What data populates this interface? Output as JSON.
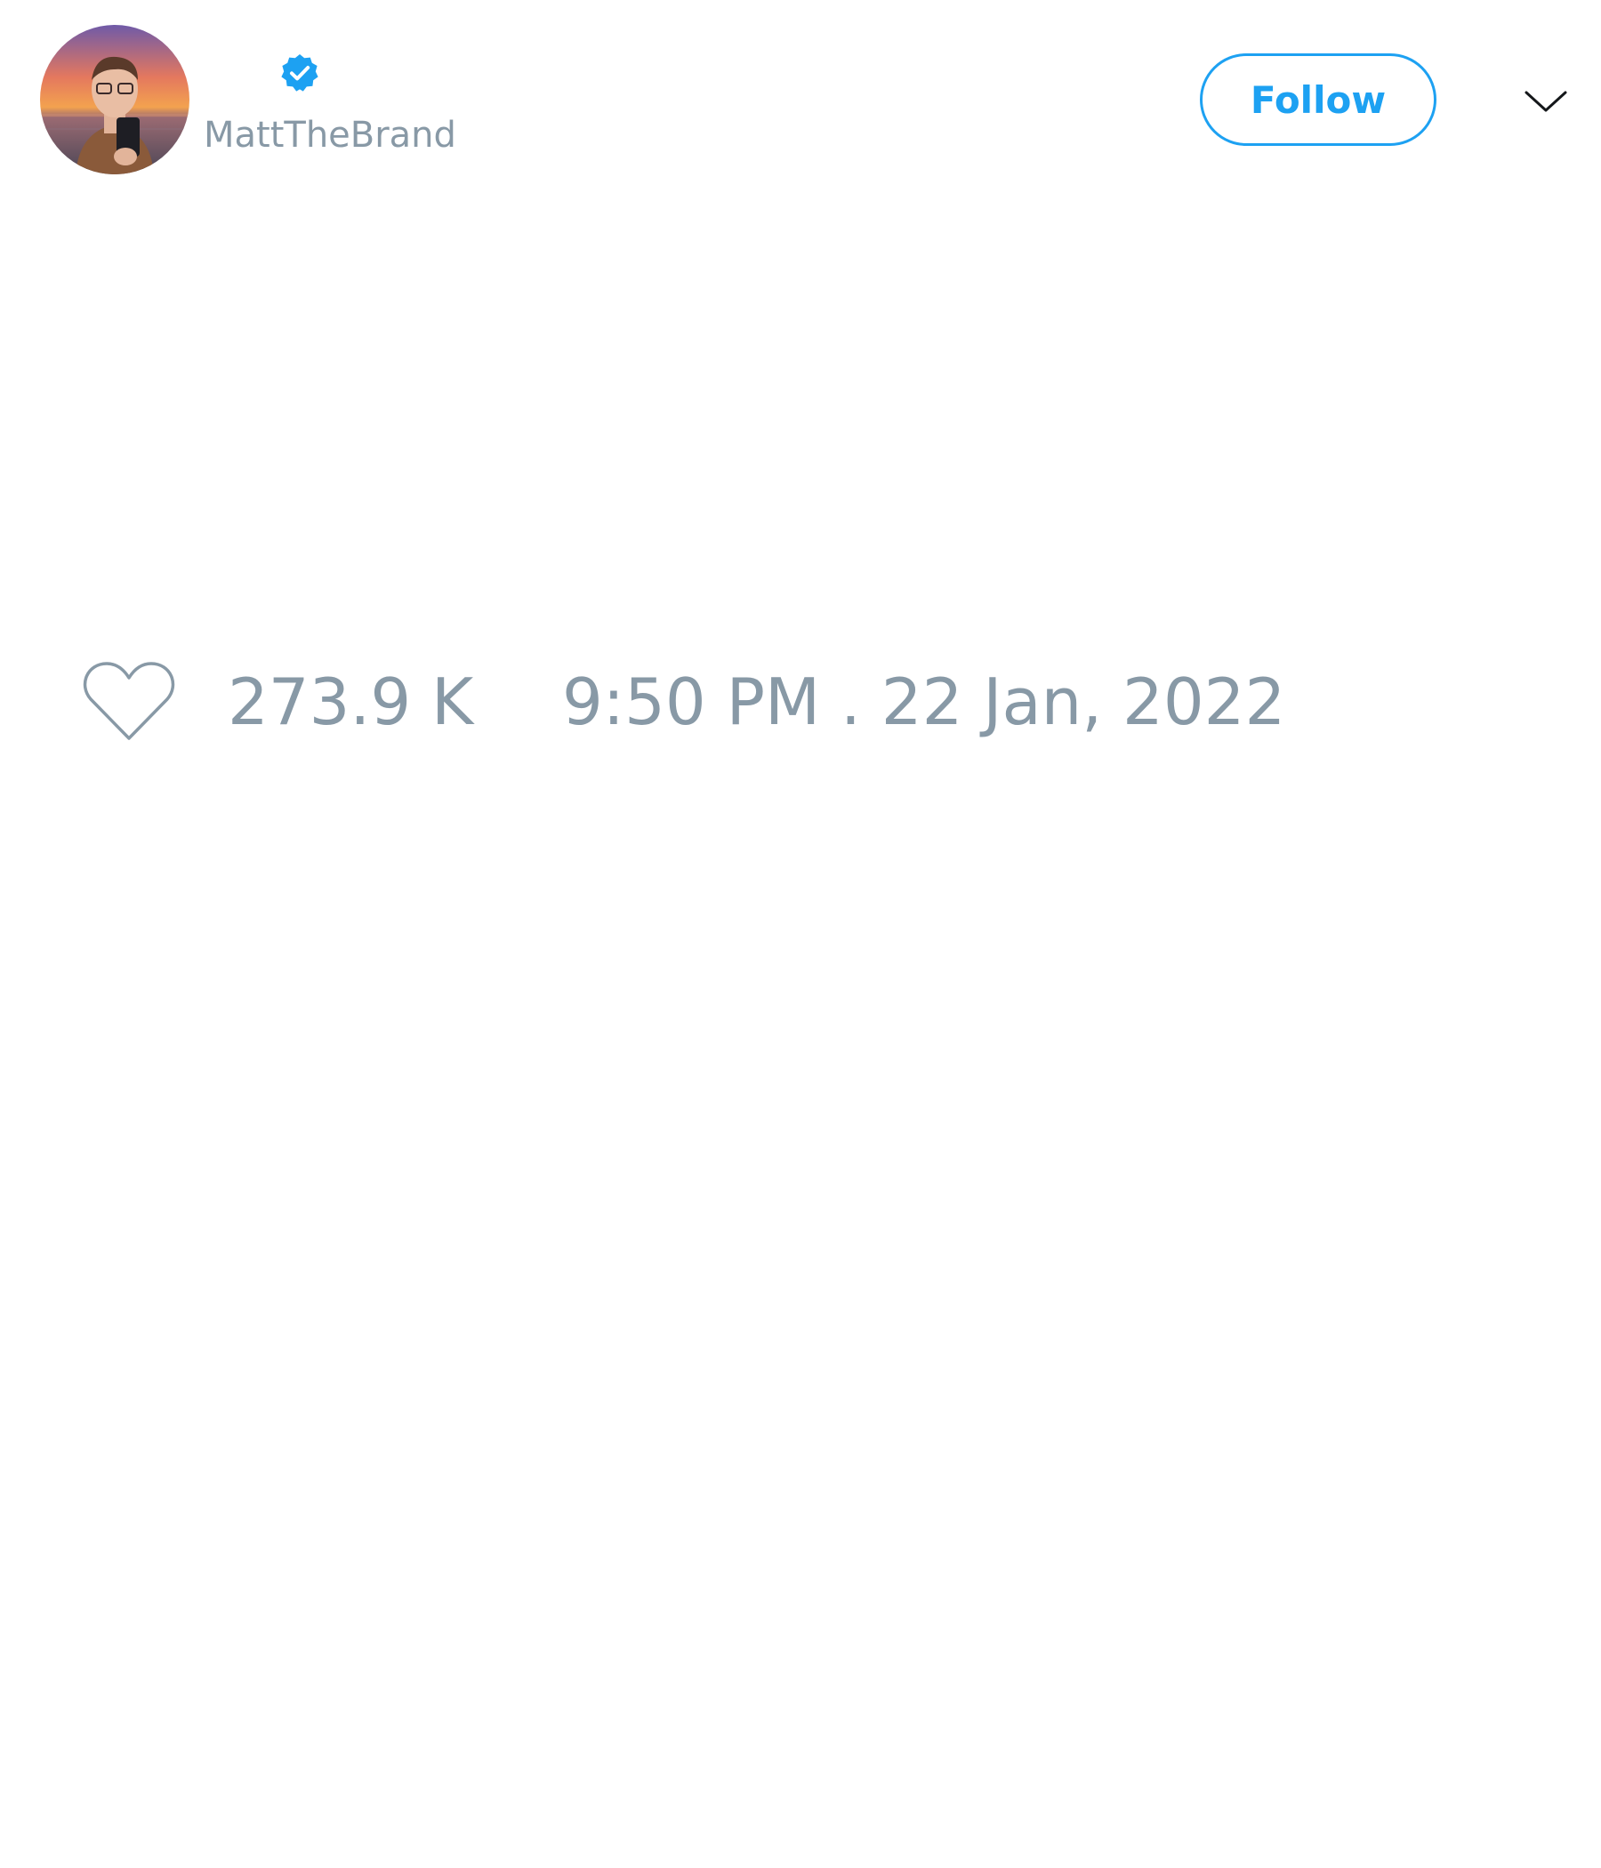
{
  "tweet": {
    "author": {
      "handle": "MattTheBrand",
      "verified": true,
      "avatar_alt": "profile photo"
    },
    "follow_label": "Follow",
    "menu_icon": "chevron-down-icon",
    "likes": "273.9 K",
    "timestamp": "9:50 PM . 22 Jan, 2022"
  },
  "colors": {
    "accent": "#1da1f2",
    "muted_text": "#8899a6",
    "icon_dark": "#14171a"
  }
}
